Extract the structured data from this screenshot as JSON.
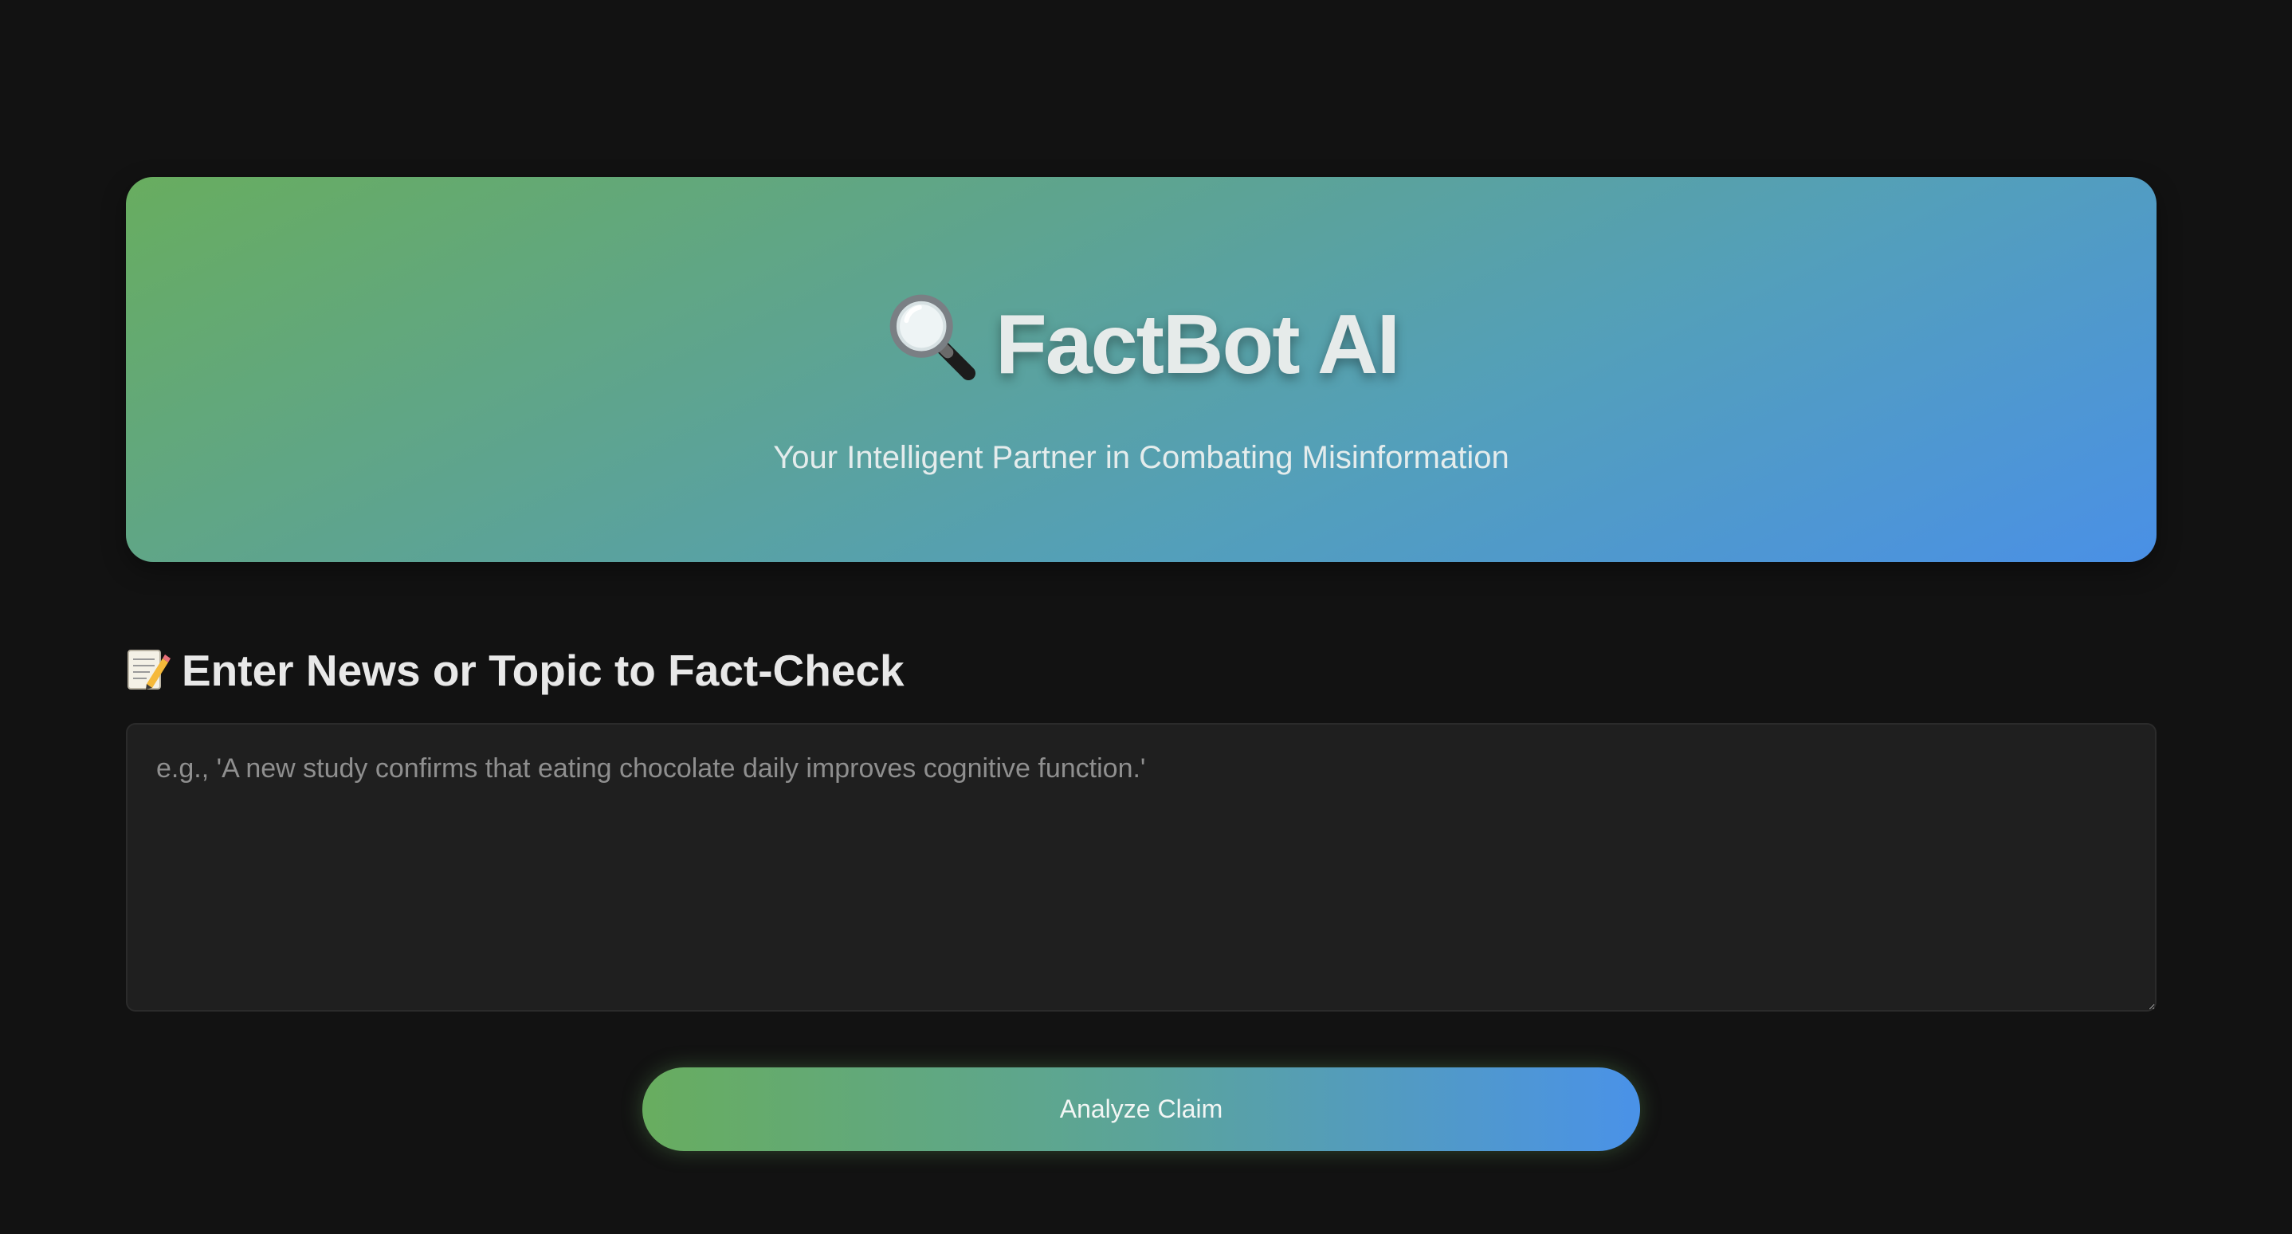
{
  "hero": {
    "title": "FactBot AI",
    "title_icon": "magnifying-glass-icon",
    "subtitle": "Your Intelligent Partner in Combating Misinformation",
    "gradient_start": "#68ad5f",
    "gradient_end": "#4a90e6"
  },
  "input_section": {
    "heading": "Enter News or Topic to Fact-Check",
    "heading_icon": "memo-icon",
    "placeholder": "e.g., 'A new study confirms that eating chocolate daily improves cognitive function.'",
    "value": ""
  },
  "actions": {
    "analyze_label": "Analyze Claim"
  },
  "colors": {
    "background": "#121212",
    "input_background": "#1f1f1f",
    "text": "#e8e8e8"
  }
}
